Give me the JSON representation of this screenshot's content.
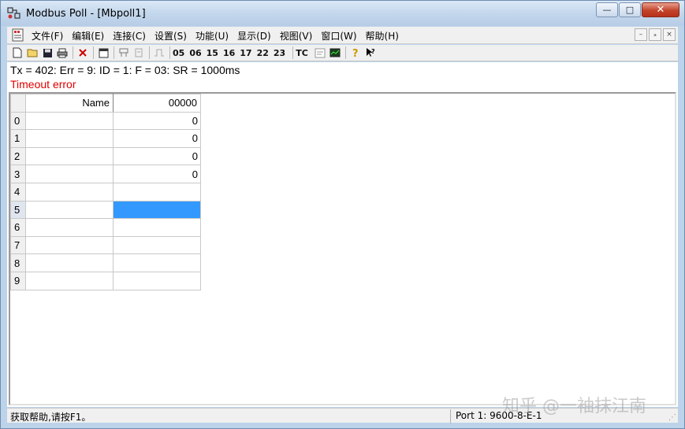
{
  "window": {
    "title": "Modbus Poll - [Mbpoll1]",
    "minimize": "—",
    "maximize": "□",
    "close": "✕"
  },
  "menu": {
    "items": [
      "文件(F)",
      "编辑(E)",
      "连接(C)",
      "设置(S)",
      "功能(U)",
      "显示(D)",
      "视图(V)",
      "窗口(W)",
      "帮助(H)"
    ],
    "mdi": [
      "–",
      "ₐ",
      "×"
    ]
  },
  "toolbar": {
    "function_codes": [
      "05",
      "06",
      "15",
      "16",
      "17",
      "22",
      "23"
    ],
    "tc_label": "TC"
  },
  "poll": {
    "status": "Tx = 402: Err = 9: ID = 1: F = 03: SR = 1000ms",
    "error": "Timeout error"
  },
  "grid": {
    "headers": {
      "name": "Name",
      "address": "00000"
    },
    "rows": [
      {
        "index": "0",
        "name": "",
        "value": "0"
      },
      {
        "index": "1",
        "name": "",
        "value": "0"
      },
      {
        "index": "2",
        "name": "",
        "value": "0"
      },
      {
        "index": "3",
        "name": "",
        "value": "0"
      },
      {
        "index": "4",
        "name": "",
        "value": ""
      },
      {
        "index": "5",
        "name": "",
        "value": ""
      },
      {
        "index": "6",
        "name": "",
        "value": ""
      },
      {
        "index": "7",
        "name": "",
        "value": ""
      },
      {
        "index": "8",
        "name": "",
        "value": ""
      },
      {
        "index": "9",
        "name": "",
        "value": ""
      }
    ],
    "selected_row": 5
  },
  "statusbar": {
    "help": "获取帮助,请按F1。",
    "port": "Port 1: 9600-8-E-1"
  },
  "watermark": "知乎 @一袖抹江南",
  "colors": {
    "error_text": "#e00000",
    "selection": "#3399ff",
    "close_button": "#c2432a"
  }
}
